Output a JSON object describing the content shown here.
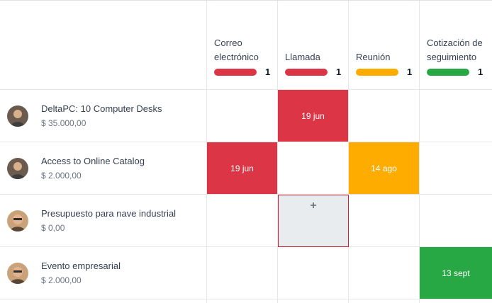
{
  "columns": [
    {
      "title": "Correo electrónico",
      "count": "1",
      "color": "#dc3545"
    },
    {
      "title": "Llamada",
      "count": "1",
      "color": "#dc3545"
    },
    {
      "title": "Reunión",
      "count": "1",
      "color": "#ffac00"
    },
    {
      "title": "Cotización de seguimiento",
      "count": "1",
      "color": "#28a745"
    }
  ],
  "rows": [
    {
      "name": "DeltaPC: 10 Computer Desks",
      "amount": "$ 35.000,00",
      "activity": {
        "column": 1,
        "label": "19 jun",
        "color": "#dc3545"
      }
    },
    {
      "name": "Access to Online Catalog",
      "amount": "$ 2.000,00",
      "activities": [
        {
          "column": 0,
          "label": "19 jun",
          "color": "#dc3545"
        },
        {
          "column": 2,
          "label": "14 ago",
          "color": "#ffac00"
        }
      ]
    },
    {
      "name": "Presupuesto para nave industrial",
      "amount": "$ 0,00",
      "add_cell": {
        "column": 1,
        "label": "+"
      }
    },
    {
      "name": "Evento empresarial",
      "amount": "$ 2.000,00",
      "activity": {
        "column": 3,
        "label": "13 sept",
        "color": "#28a745"
      }
    }
  ]
}
